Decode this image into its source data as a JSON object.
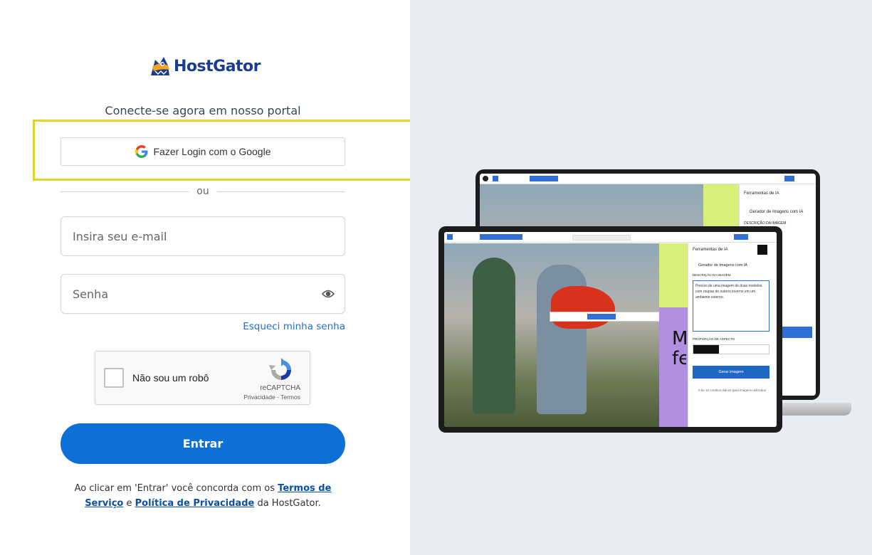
{
  "brand": {
    "name": "HostGator"
  },
  "login": {
    "subtitle": "Conecte-se agora em nosso portal",
    "google_label": "Fazer Login com o Google",
    "divider": "ou",
    "email_placeholder": "Insira seu e-mail",
    "password_placeholder": "Senha",
    "forgot_label": "Esqueci minha senha",
    "submit_label": "Entrar"
  },
  "captcha": {
    "label": "Não sou um robô",
    "brand": "reCAPTCHA",
    "privacy": "Privacidade",
    "separator": " - ",
    "terms": "Termos"
  },
  "legal": {
    "prefix": "Ao clicar em 'Entrar' você concorda com os ",
    "terms_link": "Termos de Serviço",
    "middle": " e ",
    "privacy_link": "Política de Privacidade",
    "suffix": " da HostGator."
  },
  "illustration": {
    "panel_title": "Ferramentas de IA",
    "panel_subtitle": "Gerador de Imagens com IA",
    "desc_label": "DESCRIÇÃO DA IMAGEM",
    "desc_text": "Preciso de uma imagem de duas modelos com roupas de outono inverno em um ambiente externo.",
    "aspect_label": "PROPORÇÃO DE ASPECTO",
    "generate_label": "Gerar imagem",
    "credits_text": "0 de 10 créditos diários para imagens utilizados",
    "headline": "M fe"
  },
  "colors": {
    "primary": "#0e6fd5",
    "highlight": "#e8d22a",
    "link": "#1c6fd1",
    "panel_bg": "#e9ecf2"
  }
}
